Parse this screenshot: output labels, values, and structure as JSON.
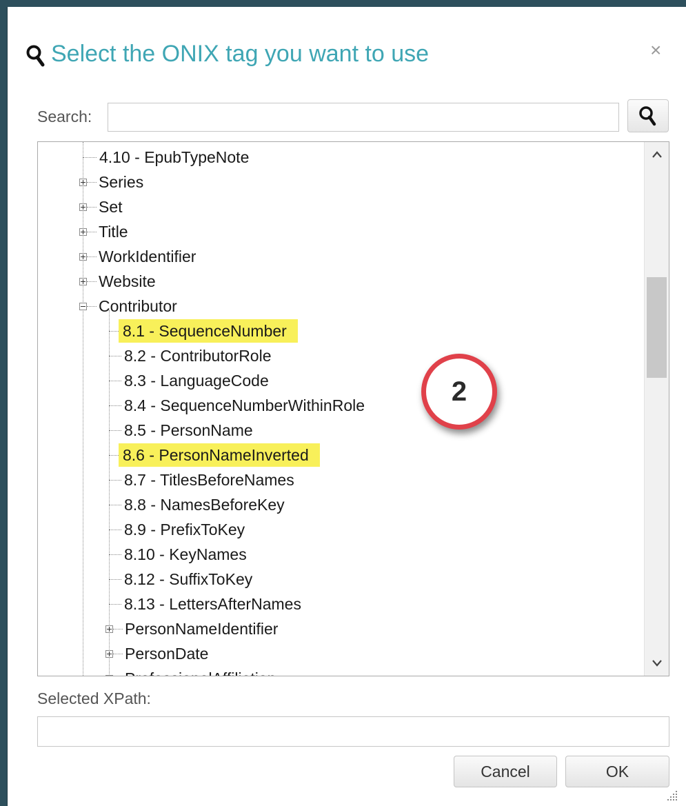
{
  "dialog": {
    "title": "Select the ONIX tag you want to use",
    "close_icon": "×"
  },
  "search": {
    "label": "Search:",
    "value": "",
    "placeholder": ""
  },
  "tree": {
    "items": [
      {
        "label": "4.10 - EpubTypeNote",
        "highlight": false
      },
      {
        "label": "Series",
        "expander": "plus"
      },
      {
        "label": "Set",
        "expander": "plus"
      },
      {
        "label": "Title",
        "expander": "plus"
      },
      {
        "label": "WorkIdentifier",
        "expander": "plus"
      },
      {
        "label": "Website",
        "expander": "plus"
      },
      {
        "label": "Contributor",
        "expander": "minus"
      },
      {
        "label": "8.1 - SequenceNumber",
        "highlight": true
      },
      {
        "label": "8.2 - ContributorRole",
        "highlight": false
      },
      {
        "label": "8.3 - LanguageCode",
        "highlight": false
      },
      {
        "label": "8.4 - SequenceNumberWithinRole",
        "highlight": false
      },
      {
        "label": "8.5 - PersonName",
        "highlight": false
      },
      {
        "label": "8.6 - PersonNameInverted",
        "highlight": true
      },
      {
        "label": "8.7 - TitlesBeforeNames",
        "highlight": false
      },
      {
        "label": "8.8 - NamesBeforeKey",
        "highlight": false
      },
      {
        "label": "8.9 - PrefixToKey",
        "highlight": false
      },
      {
        "label": "8.10 - KeyNames",
        "highlight": false
      },
      {
        "label": "8.12 - SuffixToKey",
        "highlight": false
      },
      {
        "label": "8.13 - LettersAfterNames",
        "highlight": false
      },
      {
        "label": "PersonNameIdentifier",
        "expander": "plus"
      },
      {
        "label": "PersonDate",
        "expander": "plus"
      },
      {
        "label": "ProfessionalAffiliation",
        "expander": "plus"
      }
    ],
    "highlight_color": "#f8f05a"
  },
  "xpath": {
    "label": "Selected XPath:",
    "value": ""
  },
  "buttons": {
    "cancel": "Cancel",
    "ok": "OK"
  },
  "annotation": {
    "number": "2",
    "ring_color": "#e0414a"
  },
  "colors": {
    "title": "#3fa6b4",
    "frame": "#2d4f5c"
  }
}
